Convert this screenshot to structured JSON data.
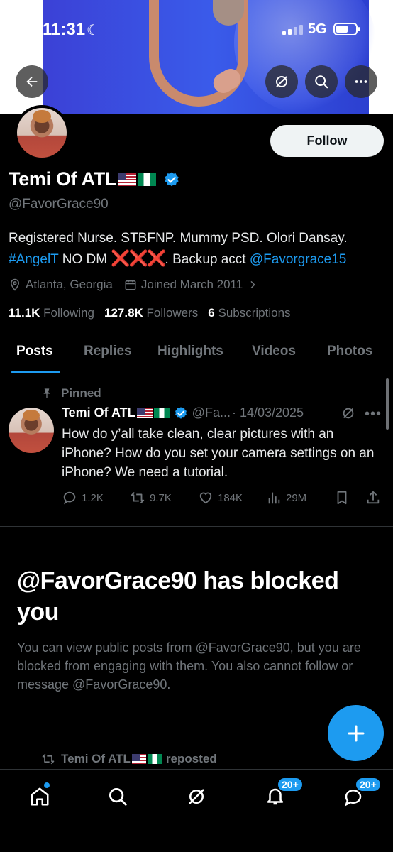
{
  "status_bar": {
    "time": "11:31",
    "network": "5G"
  },
  "profile": {
    "display_name": "Temi Of ATL",
    "handle": "@FavorGrace90",
    "follow_label": "Follow",
    "bio": {
      "line1": "Registered Nurse. STBFNP. Mummy PSD. Olori Dansay.",
      "hashtag": "#AngelT",
      "no_dm": " NO DM ",
      "x_marks": "❌❌❌",
      "backup_text": ". Backup acct ",
      "backup_handle": "@Favorgrace15"
    },
    "location": "Atlanta, Georgia",
    "joined": "Joined March 2011",
    "following_count": "11.1K",
    "following_label": "Following",
    "followers_count": "127.8K",
    "followers_label": "Followers",
    "subscriptions_count": "6",
    "subscriptions_label": "Subscriptions"
  },
  "tabs": [
    "Posts",
    "Replies",
    "Highlights",
    "Videos",
    "Photos"
  ],
  "pinned_post": {
    "pinned_label": "Pinned",
    "author_name": "Temi Of ATL",
    "author_handle": "@Fa...",
    "date": "· 14/03/2025",
    "text": "How do y’all take clean, clear pictures with an iPhone? How do you set your camera settings on an iPhone? We need a tutorial.",
    "replies": "1.2K",
    "reposts": "9.7K",
    "likes": "184K",
    "views": "29M"
  },
  "blocked_notice": {
    "title": "@FavorGrace90 has blocked you",
    "description": "You can view public posts from @FavorGrace90, but you are blocked from engaging with them. You also cannot follow or message @FavorGrace90."
  },
  "repost_row": {
    "name": "Temi Of ATL",
    "suffix": "reposted"
  },
  "bottom_nav": {
    "notifications_badge": "20+",
    "messages_badge": "20+"
  },
  "colors": {
    "accent": "#1d9bf0",
    "background": "#000000",
    "muted": "#71767b"
  }
}
